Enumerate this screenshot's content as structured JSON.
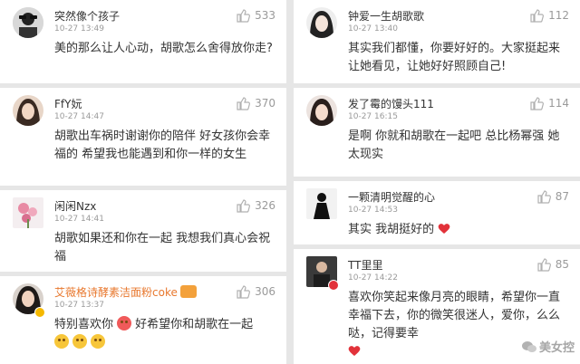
{
  "like_icon": "thumbs-up-icon",
  "colors": {
    "accent_name": "#e8782e",
    "heart": "#e2323a",
    "meta": "#9a9a9a"
  },
  "left": [
    {
      "name": "突然像个孩子",
      "time": "10-27 13:49",
      "likes": "533",
      "body": "美的那么让人心动，胡歌怎么舍得放你走?"
    },
    {
      "name": "FfY妧",
      "time": "10-27 14:47",
      "likes": "370",
      "body": "胡歌出车祸时谢谢你的陪伴 好女孩你会幸福的 希望我也能遇到和你一样的女生"
    },
    {
      "name": "闲闲Nzx",
      "time": "10-27 14:41",
      "likes": "326",
      "body": "胡歌如果还和你在一起 我想我们真心会祝福"
    },
    {
      "name": "艾薇格诗酵素洁面粉coke",
      "time": "10-27 13:37",
      "likes": "306",
      "body_prefix": "特别喜欢你",
      "body_suffix": "好希望你和胡歌在一起"
    }
  ],
  "right": [
    {
      "name": "钟爱一生胡歌歌",
      "time": "10-27 13:40",
      "likes": "112",
      "body": "其实我们都懂，你要好好的。大家挺起来让她看见，让她好好照顾自己!"
    },
    {
      "name": "发了霉的馒头111",
      "time": "10-27 16:15",
      "likes": "114",
      "body": "是啊 你就和胡歌在一起吧 总比杨幂强  她太现实"
    },
    {
      "name": "一颗清明觉醒的心",
      "time": "10-27 14:53",
      "likes": "87",
      "body": "其实 我胡挺好的"
    },
    {
      "name": "TT里里",
      "time": "10-27 14:22",
      "likes": "85",
      "body": "喜欢你笑起来像月亮的眼睛，希望你一直幸福下去，你的微笑很迷人，爱你，么么哒，记得要幸"
    }
  ],
  "watermark": "美女控"
}
